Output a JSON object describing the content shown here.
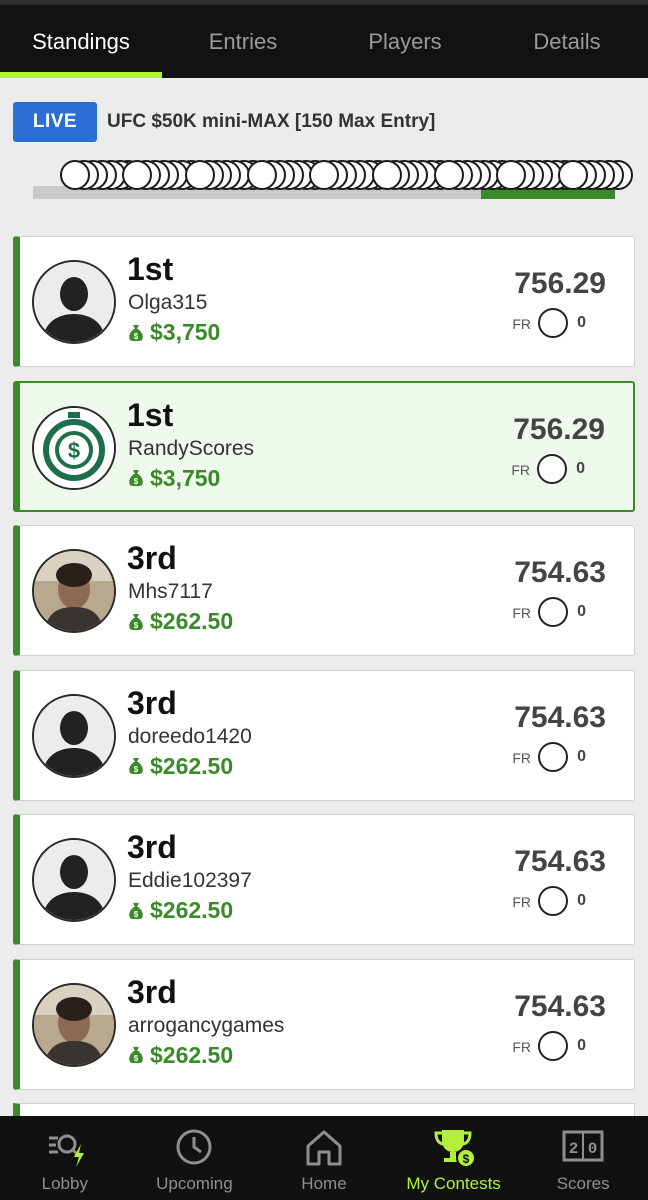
{
  "tabs": [
    {
      "label": "Standings",
      "active": true
    },
    {
      "label": "Entries",
      "active": false
    },
    {
      "label": "Players",
      "active": false
    },
    {
      "label": "Details",
      "active": false
    }
  ],
  "contest": {
    "status_badge": "LIVE",
    "title": "UFC $50K mini-MAX [150 Max Entry]"
  },
  "standings": [
    {
      "rank": "1st",
      "username": "Olga315",
      "prize": "$3,750",
      "score": "756.29",
      "fr_label": "FR",
      "fr_count": "0",
      "avatar": "default-avatar",
      "highlight": false
    },
    {
      "rank": "1st",
      "username": "RandyScores",
      "prize": "$3,750",
      "score": "756.29",
      "fr_label": "FR",
      "fr_count": "0",
      "avatar": "stopwatch-dollar-avatar",
      "highlight": true
    },
    {
      "rank": "3rd",
      "username": "Mhs7117",
      "prize": "$262.50",
      "score": "754.63",
      "fr_label": "FR",
      "fr_count": "0",
      "avatar": "photo-avatar",
      "highlight": false
    },
    {
      "rank": "3rd",
      "username": "doreedo1420",
      "prize": "$262.50",
      "score": "754.63",
      "fr_label": "FR",
      "fr_count": "0",
      "avatar": "default-avatar",
      "highlight": false
    },
    {
      "rank": "3rd",
      "username": "Eddie102397",
      "prize": "$262.50",
      "score": "754.63",
      "fr_label": "FR",
      "fr_count": "0",
      "avatar": "default-avatar",
      "highlight": false
    },
    {
      "rank": "3rd",
      "username": "arrogancygames",
      "prize": "$262.50",
      "score": "754.63",
      "fr_label": "FR",
      "fr_count": "0",
      "avatar": "photo-avatar",
      "highlight": false
    }
  ],
  "bottom_nav": [
    {
      "label": "Lobby",
      "icon": "lobby-search-bolt-icon",
      "active": false
    },
    {
      "label": "Upcoming",
      "icon": "clock-icon",
      "active": false
    },
    {
      "label": "Home",
      "icon": "home-icon",
      "active": false
    },
    {
      "label": "My Contests",
      "icon": "trophy-dollar-icon",
      "active": true
    },
    {
      "label": "Scores",
      "icon": "scoreboard-icon",
      "active": false
    }
  ],
  "colors": {
    "accent_lime": "#b4f03a",
    "prize_green": "#3a8a2a",
    "live_blue": "#2b6fd6",
    "nav_bg": "#111111"
  }
}
